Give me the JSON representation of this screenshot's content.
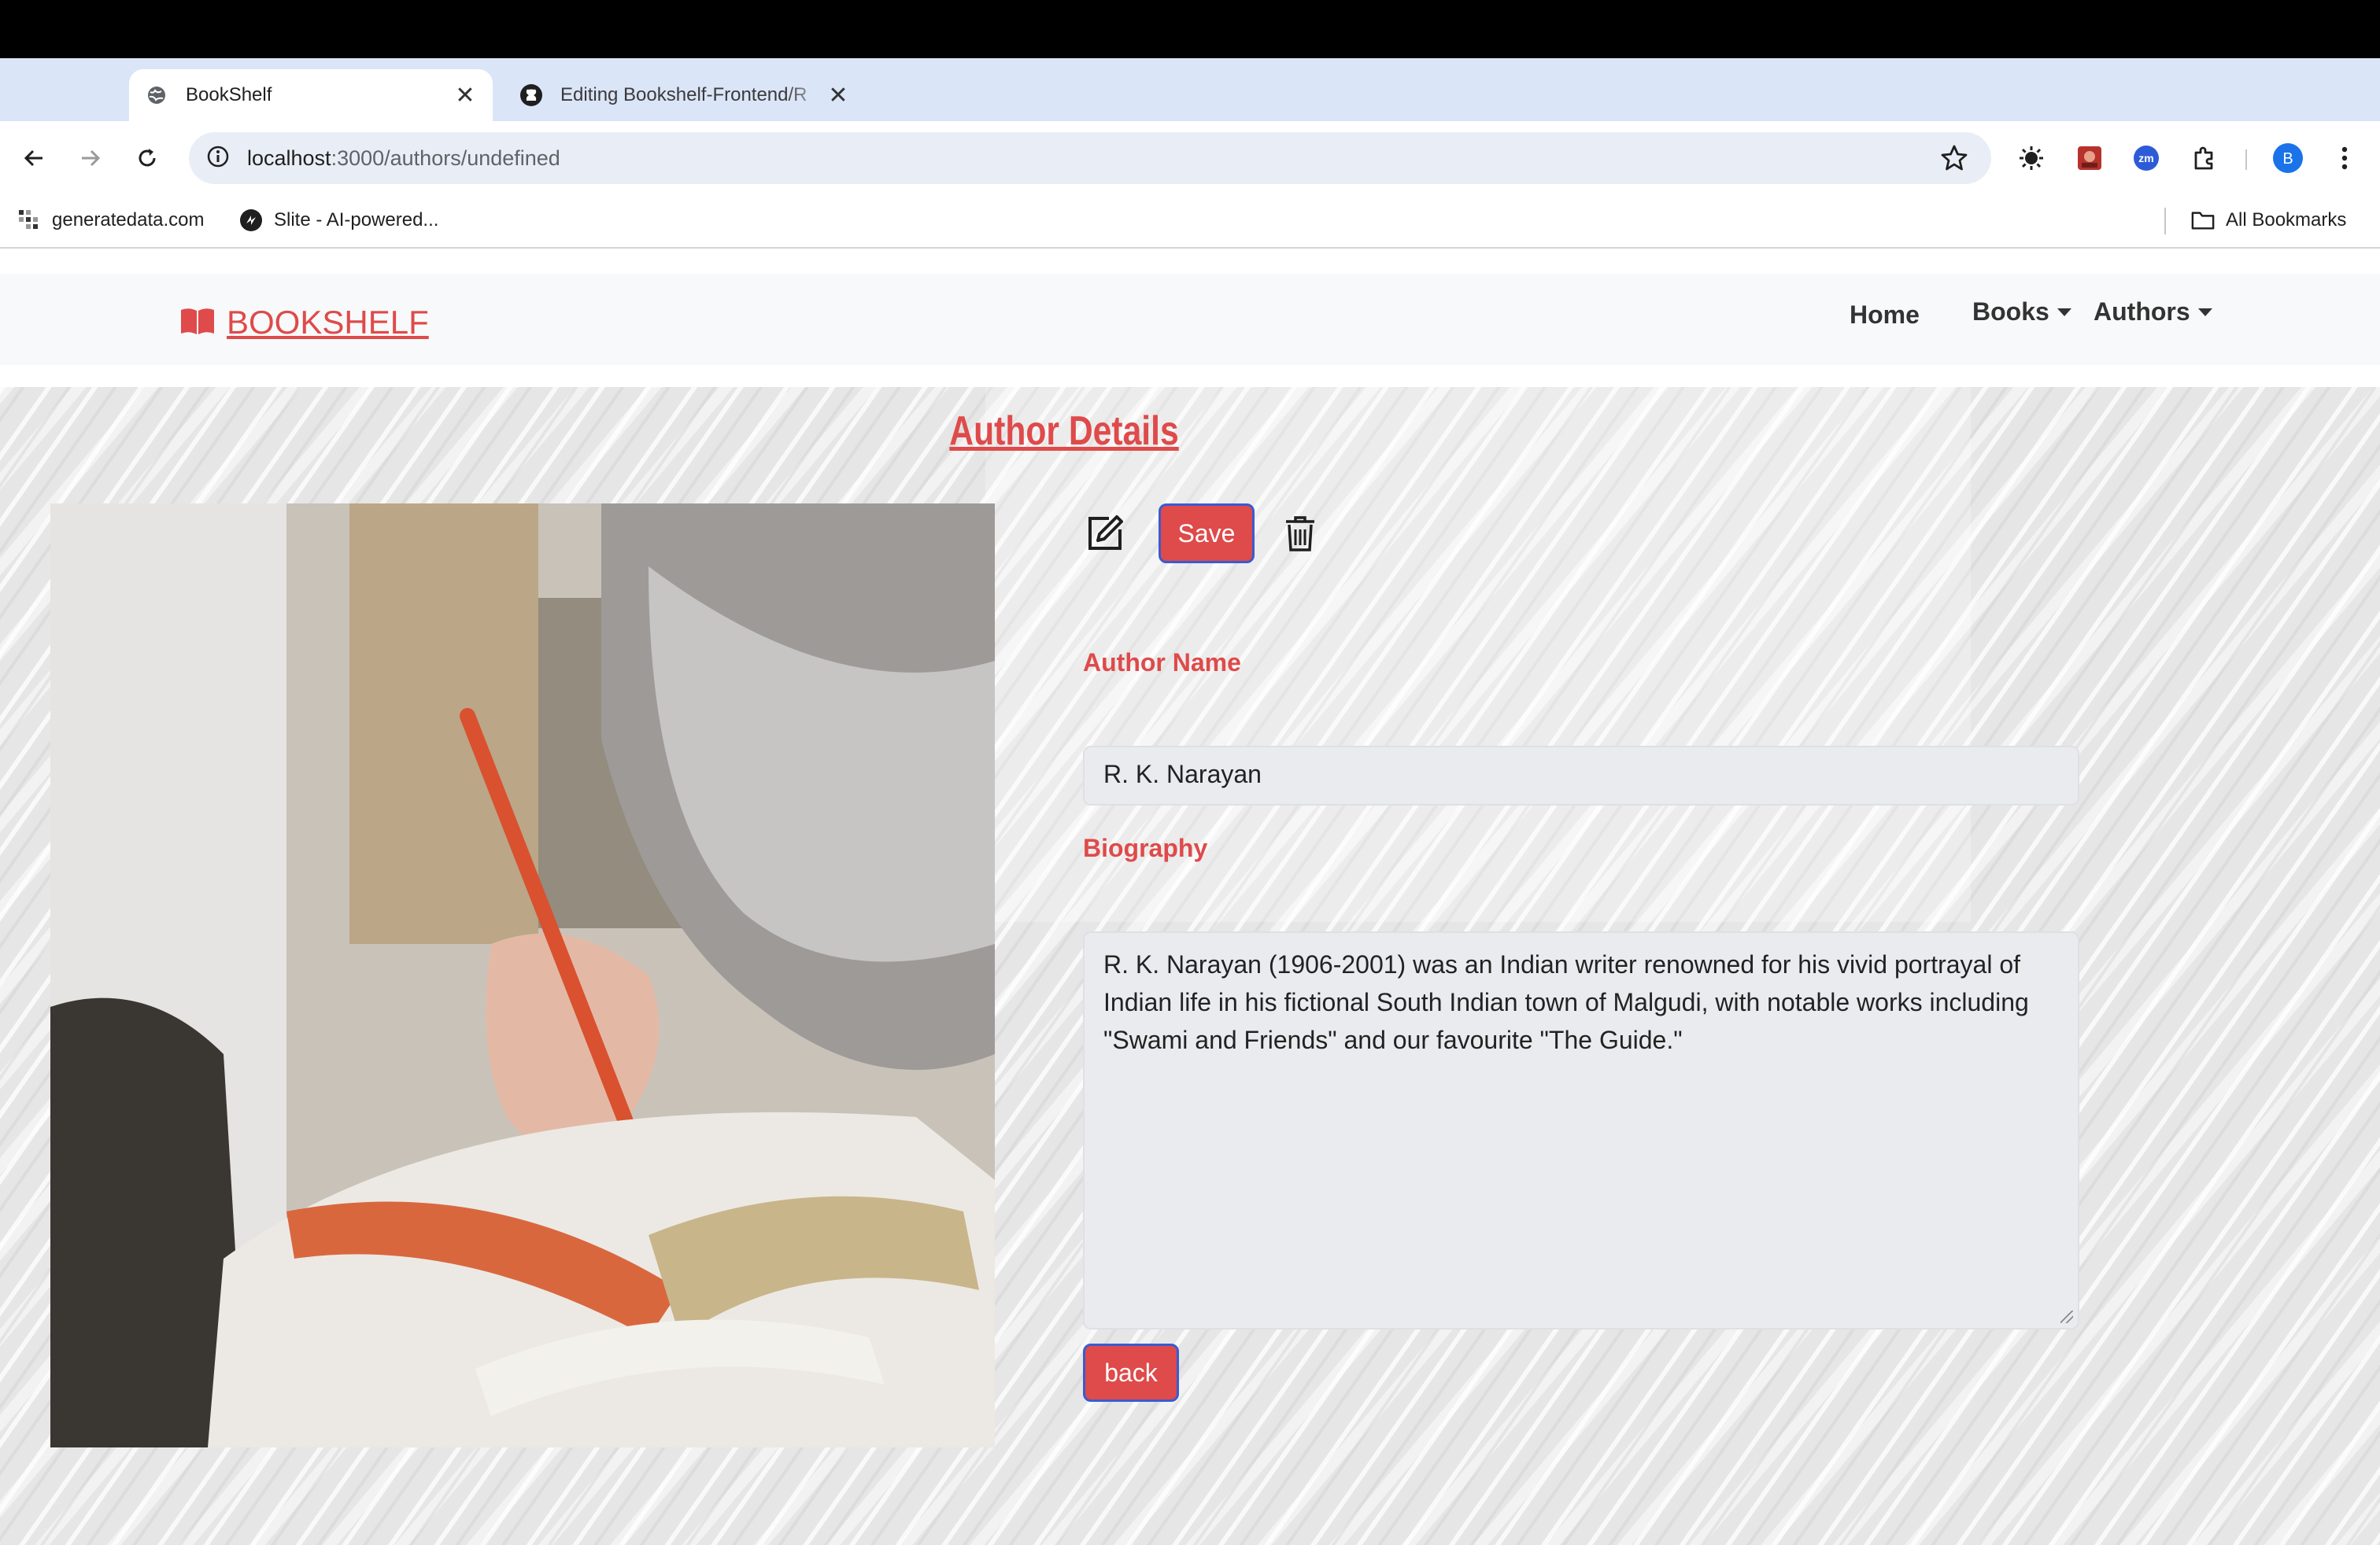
{
  "browser": {
    "tabs": [
      {
        "title": "BookShelf",
        "favicon": "globe-icon",
        "active": true
      },
      {
        "title": "Editing Bookshelf-Frontend/R",
        "favicon": "github-icon",
        "active": false
      }
    ],
    "url_host": "localhost",
    "url_path": ":3000/authors/undefined",
    "bookmarks": [
      {
        "label": "generatedata.com",
        "icon": "generatedata-icon"
      },
      {
        "label": "Slite - AI-powered...",
        "icon": "slite-icon"
      }
    ],
    "all_bookmarks_label": "All Bookmarks",
    "profile_initial": "B",
    "extension_zoom_label": "zm"
  },
  "navbar": {
    "brand": "BOOKSHELF",
    "links": {
      "home": "Home",
      "books": "Books",
      "authors": "Authors"
    }
  },
  "page": {
    "heading": "Author Details",
    "save_label": "Save",
    "back_label": "back",
    "author_name_label": "Author Name",
    "author_name_value": "R. K. Narayan",
    "biography_label": "Biography",
    "biography_value": "R. K. Narayan (1906-2001) was an Indian writer renowned for his vivid portrayal of Indian life in his fictional South Indian town of Malgudi, with notable works including \"Swami and Friends\" and our favourite \"The Guide.\""
  },
  "colors": {
    "accent": "#df4a4a",
    "button_border": "#3a5bd0",
    "tabstrip": "#dbe5f8",
    "navbar_bg": "#f8f9fa"
  }
}
